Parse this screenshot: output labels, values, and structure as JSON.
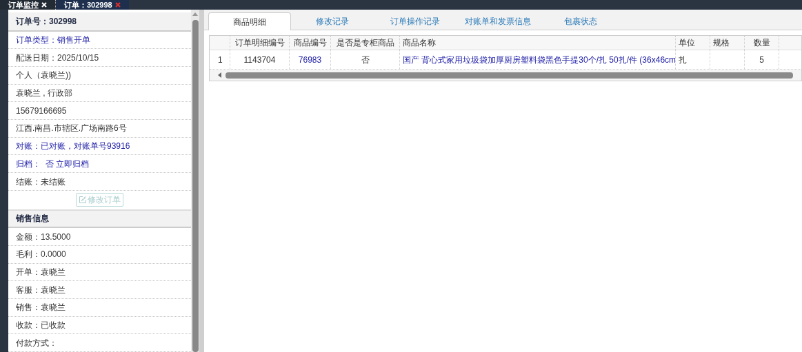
{
  "top_tabs": [
    {
      "label": "订单监控",
      "selected": false
    },
    {
      "label": "订单：302998",
      "selected": true
    }
  ],
  "order_panel": {
    "title": "订单号：302998",
    "rows": [
      {
        "text": "订单类型：销售开单",
        "kind": "link"
      },
      {
        "text": "配送日期：2025/10/15",
        "kind": "plain"
      },
      {
        "text": "个人（袁晓兰))",
        "kind": "plain"
      },
      {
        "text": "袁晓兰 , 行政部",
        "kind": "plain"
      },
      {
        "text": "15679166695",
        "kind": "plain"
      },
      {
        "text": "江西.南昌.市辖区.广场南路6号",
        "kind": "plain"
      },
      {
        "text": "对账：已对账，对账单号93916",
        "kind": "link"
      },
      {
        "text": "归档：  否 立即归档",
        "kind": "link"
      },
      {
        "text": "结账：未结账",
        "kind": "plain"
      }
    ],
    "edit_button": {
      "label": "修改订单",
      "disabled": true
    }
  },
  "sales_panel": {
    "title": "销售信息",
    "rows": [
      {
        "text": "金额：13.5000"
      },
      {
        "text": "毛利：0.0000"
      },
      {
        "text": "开单：袁晓兰"
      },
      {
        "text": "客服：袁晓兰"
      },
      {
        "text": "销售：袁晓兰"
      },
      {
        "text": "收款：已收款"
      },
      {
        "text": "付款方式："
      }
    ]
  },
  "detail_tabs": [
    {
      "label": "商品明细",
      "selected": true
    },
    {
      "label": "修改记录",
      "selected": false
    },
    {
      "label": "订单操作记录",
      "selected": false
    },
    {
      "label": "对账单和发票信息",
      "selected": false
    },
    {
      "label": "包裹状态",
      "selected": false
    }
  ],
  "table": {
    "columns": [
      "订单明细编号",
      "商品编号",
      "是否是专柜商品",
      "商品名称",
      "单位",
      "规格",
      "数量"
    ],
    "rows": [
      {
        "number": "1",
        "cells": [
          {
            "text": "1143704",
            "kind": "plain"
          },
          {
            "text": "76983",
            "kind": "link"
          },
          {
            "text": "否",
            "kind": "plain"
          },
          {
            "text": "国产 背心式家用垃圾袋加厚厨房塑料袋黑色手提30个/扎 50扎/件 (36x46cm",
            "kind": "link"
          },
          {
            "text": "扎",
            "kind": "plain"
          },
          {
            "kind": "plain"
          },
          {
            "text": "5",
            "kind": "plain"
          }
        ]
      }
    ]
  }
}
